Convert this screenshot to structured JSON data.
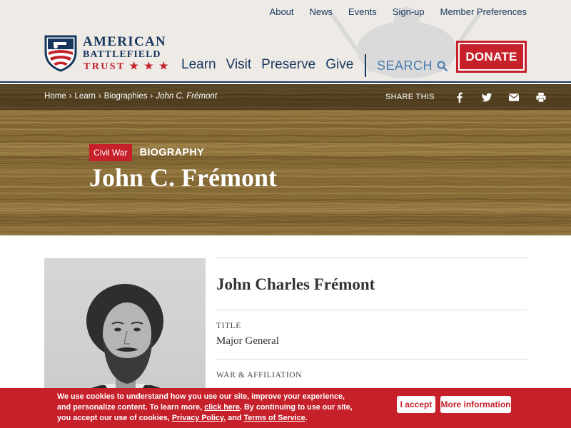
{
  "header": {
    "top_nav": [
      "About",
      "News",
      "Events",
      "Sign-up",
      "Member Preferences"
    ],
    "logo": {
      "line1": "AMERICAN",
      "line2": "BATTLEFIELD",
      "line3": "TRUST ★ ★ ★"
    },
    "main_nav": [
      "Learn",
      "Visit",
      "Preserve",
      "Give"
    ],
    "search_label": "SEARCH",
    "search_icon": "search-icon",
    "donate_label": "DONATE"
  },
  "breadcrumb": {
    "items": [
      "Home",
      "Learn",
      "Biographies"
    ],
    "separator": "›",
    "current": "John C. Frémont"
  },
  "share": {
    "label": "SHARE THIS",
    "icons": [
      "facebook-icon",
      "twitter-icon",
      "email-icon",
      "print-icon"
    ]
  },
  "hero": {
    "tag": "Civil War",
    "type": "BIOGRAPHY",
    "title": "John C. Frémont"
  },
  "profile": {
    "full_name": "John Charles Frémont",
    "fields": [
      {
        "label": "TITLE",
        "value": "Major General"
      },
      {
        "label": "WAR & AFFILIATION",
        "value": ""
      }
    ]
  },
  "cookie_banner": {
    "text_1": "We use cookies to understand how you use our site, improve your experience, and personalize content. To learn more, ",
    "link_1": "click here",
    "text_2": ". By continuing to use our site, you accept our use of cookies, ",
    "link_2": "Privacy Policy",
    "text_3": ", and ",
    "link_3": "Terms of Service",
    "text_4": ".",
    "accept_label": "I accept",
    "more_label": "More information"
  },
  "colors": {
    "navy": "#17365e",
    "red": "#c6202b",
    "search_blue": "#4b7eaf",
    "header_bg": "#eeebe6",
    "wood": "#8a6f3a"
  }
}
